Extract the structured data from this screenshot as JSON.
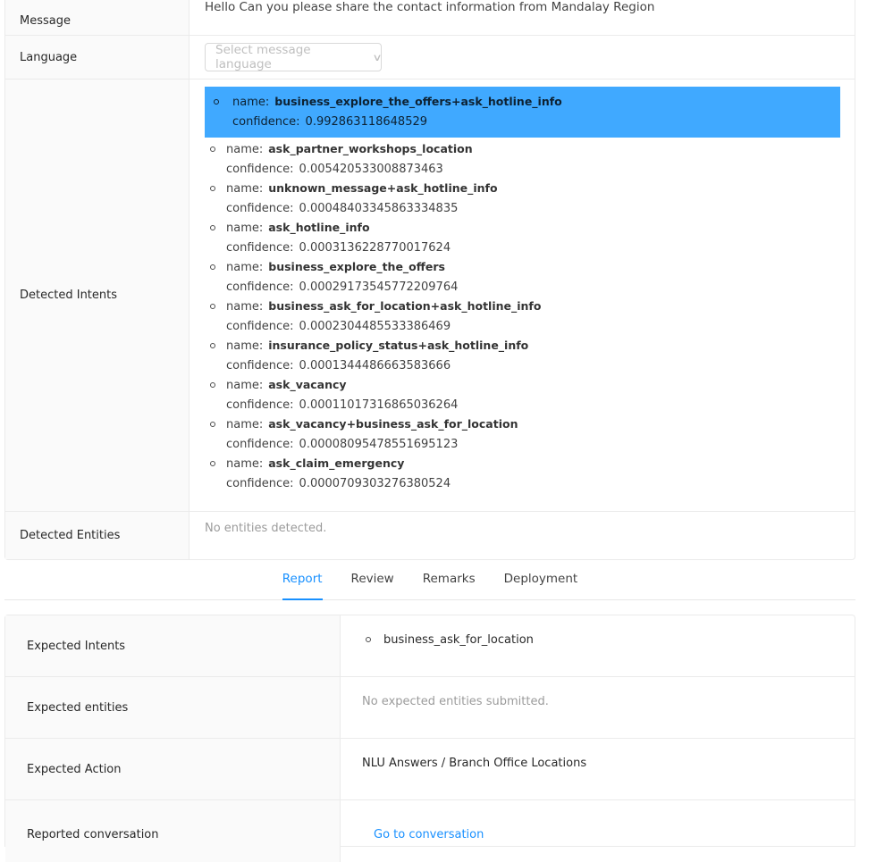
{
  "details": {
    "message": {
      "label": "Message",
      "value": "Hello Can you please share the contact information from Mandalay Region"
    },
    "language": {
      "label": "Language",
      "placeholder": "Select message language"
    },
    "detected_intents": {
      "label": "Detected Intents",
      "name_key": "name:",
      "confidence_key": "confidence:",
      "items": [
        {
          "name": "business_explore_the_offers+ask_hotline_info",
          "confidence": "0.992863118648529",
          "selected": true
        },
        {
          "name": "ask_partner_workshops_location",
          "confidence": "0.005420533008873463"
        },
        {
          "name": "unknown_message+ask_hotline_info",
          "confidence": "0.00048403345863334835"
        },
        {
          "name": "ask_hotline_info",
          "confidence": "0.0003136228770017624"
        },
        {
          "name": "business_explore_the_offers",
          "confidence": "0.00029173545772209764"
        },
        {
          "name": "business_ask_for_location+ask_hotline_info",
          "confidence": "0.0002304485533386469"
        },
        {
          "name": "insurance_policy_status+ask_hotline_info",
          "confidence": "0.0001344486663583666"
        },
        {
          "name": "ask_vacancy",
          "confidence": "0.00011017316865036264"
        },
        {
          "name": "ask_vacancy+business_ask_for_location",
          "confidence": "0.00008095478551695123"
        },
        {
          "name": "ask_claim_emergency",
          "confidence": "0.0000709303276380524"
        }
      ]
    },
    "detected_entities": {
      "label": "Detected Entities",
      "empty_text": "No entities detected."
    }
  },
  "tabs": [
    {
      "label": "Report",
      "active": true
    },
    {
      "label": "Review"
    },
    {
      "label": "Remarks"
    },
    {
      "label": "Deployment"
    }
  ],
  "report": {
    "expected_intents": {
      "label": "Expected Intents",
      "items": [
        "business_ask_for_location"
      ]
    },
    "expected_entities": {
      "label": "Expected entities",
      "empty_text": "No expected entities submitted."
    },
    "expected_action": {
      "label": "Expected Action",
      "value": "NLU Answers / Branch Office Locations"
    },
    "reported_conversation": {
      "label": "Reported conversation",
      "link": "Go to conversation"
    }
  },
  "colors": {
    "accent": "#1890ff",
    "selected_highlight": "#40a9ff",
    "label_bg": "#fafafa",
    "border": "#ebebeb"
  }
}
